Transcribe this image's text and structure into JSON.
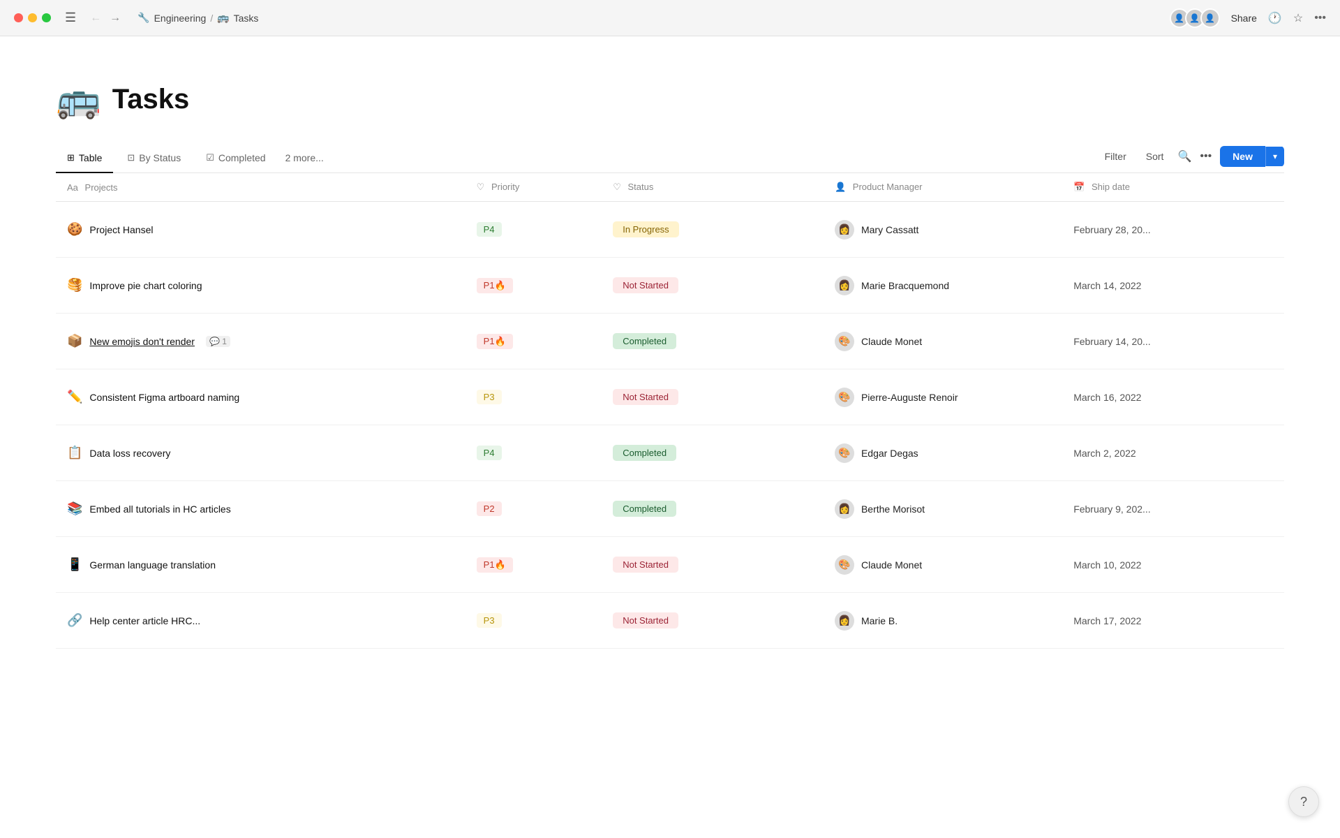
{
  "titlebar": {
    "breadcrumb_section": "Engineering",
    "breadcrumb_sep": "/",
    "breadcrumb_page": "Tasks",
    "section_emoji": "🔧",
    "page_emoji": "🚌",
    "share_label": "Share"
  },
  "page": {
    "emoji": "🚌",
    "title": "Tasks"
  },
  "tabs": [
    {
      "id": "table",
      "icon": "⊞",
      "label": "Table",
      "active": true
    },
    {
      "id": "by-status",
      "icon": "⊡",
      "label": "By Status",
      "active": false
    },
    {
      "id": "completed",
      "icon": "☑",
      "label": "Completed",
      "active": false
    }
  ],
  "more_tabs_label": "2 more...",
  "toolbar": {
    "filter_label": "Filter",
    "sort_label": "Sort",
    "new_label": "New"
  },
  "columns": [
    {
      "id": "projects",
      "icon": "Aa",
      "label": "Projects"
    },
    {
      "id": "priority",
      "icon": "♡",
      "label": "Priority"
    },
    {
      "id": "status",
      "icon": "♡",
      "label": "Status"
    },
    {
      "id": "pm",
      "icon": "👤",
      "label": "Product Manager"
    },
    {
      "id": "ship_date",
      "icon": "📅",
      "label": "Ship date"
    }
  ],
  "rows": [
    {
      "emoji": "🍪",
      "name": "Project Hansel",
      "underline": false,
      "comment_count": null,
      "priority": "P4",
      "priority_class": "p4",
      "status": "In Progress",
      "status_class": "status-in-progress",
      "pm_avatar": "👩",
      "pm_name": "Mary Cassatt",
      "ship_date": "February 28, 20..."
    },
    {
      "emoji": "🥞",
      "name": "Improve pie chart coloring",
      "underline": false,
      "comment_count": null,
      "priority": "P1🔥",
      "priority_class": "p1",
      "status": "Not Started",
      "status_class": "status-not-started",
      "pm_avatar": "👩",
      "pm_name": "Marie Bracquemond",
      "ship_date": "March 14, 2022"
    },
    {
      "emoji": "📦",
      "name": "New emojis don't render",
      "underline": true,
      "comment_count": "1",
      "priority": "P1🔥",
      "priority_class": "p1",
      "status": "Completed",
      "status_class": "status-completed",
      "pm_avatar": "🎨",
      "pm_name": "Claude Monet",
      "ship_date": "February 14, 20..."
    },
    {
      "emoji": "✏️",
      "name": "Consistent Figma artboard naming",
      "underline": false,
      "comment_count": null,
      "priority": "P3",
      "priority_class": "p3",
      "status": "Not Started",
      "status_class": "status-not-started",
      "pm_avatar": "🎨",
      "pm_name": "Pierre-Auguste Renoir",
      "ship_date": "March 16, 2022"
    },
    {
      "emoji": "📋",
      "name": "Data loss recovery",
      "underline": false,
      "comment_count": null,
      "priority": "P4",
      "priority_class": "p4",
      "status": "Completed",
      "status_class": "status-completed",
      "pm_avatar": "🎨",
      "pm_name": "Edgar Degas",
      "ship_date": "March 2, 2022"
    },
    {
      "emoji": "📚",
      "name": "Embed all tutorials in HC articles",
      "underline": false,
      "comment_count": null,
      "priority": "P2",
      "priority_class": "p2",
      "status": "Completed",
      "status_class": "status-completed",
      "pm_avatar": "👩",
      "pm_name": "Berthe Morisot",
      "ship_date": "February 9, 202..."
    },
    {
      "emoji": "📱",
      "name": "German language translation",
      "underline": false,
      "comment_count": null,
      "priority": "P1🔥",
      "priority_class": "p1",
      "status": "Not Started",
      "status_class": "status-not-started",
      "pm_avatar": "🎨",
      "pm_name": "Claude Monet",
      "ship_date": "March 10, 2022"
    },
    {
      "emoji": "🔗",
      "name": "Help center article HRC...",
      "underline": false,
      "comment_count": null,
      "priority": "P3",
      "priority_class": "p3",
      "status": "Not Started",
      "status_class": "status-not-started",
      "pm_avatar": "👩",
      "pm_name": "Marie B.",
      "ship_date": "March 17, 2022"
    }
  ],
  "help_label": "?"
}
